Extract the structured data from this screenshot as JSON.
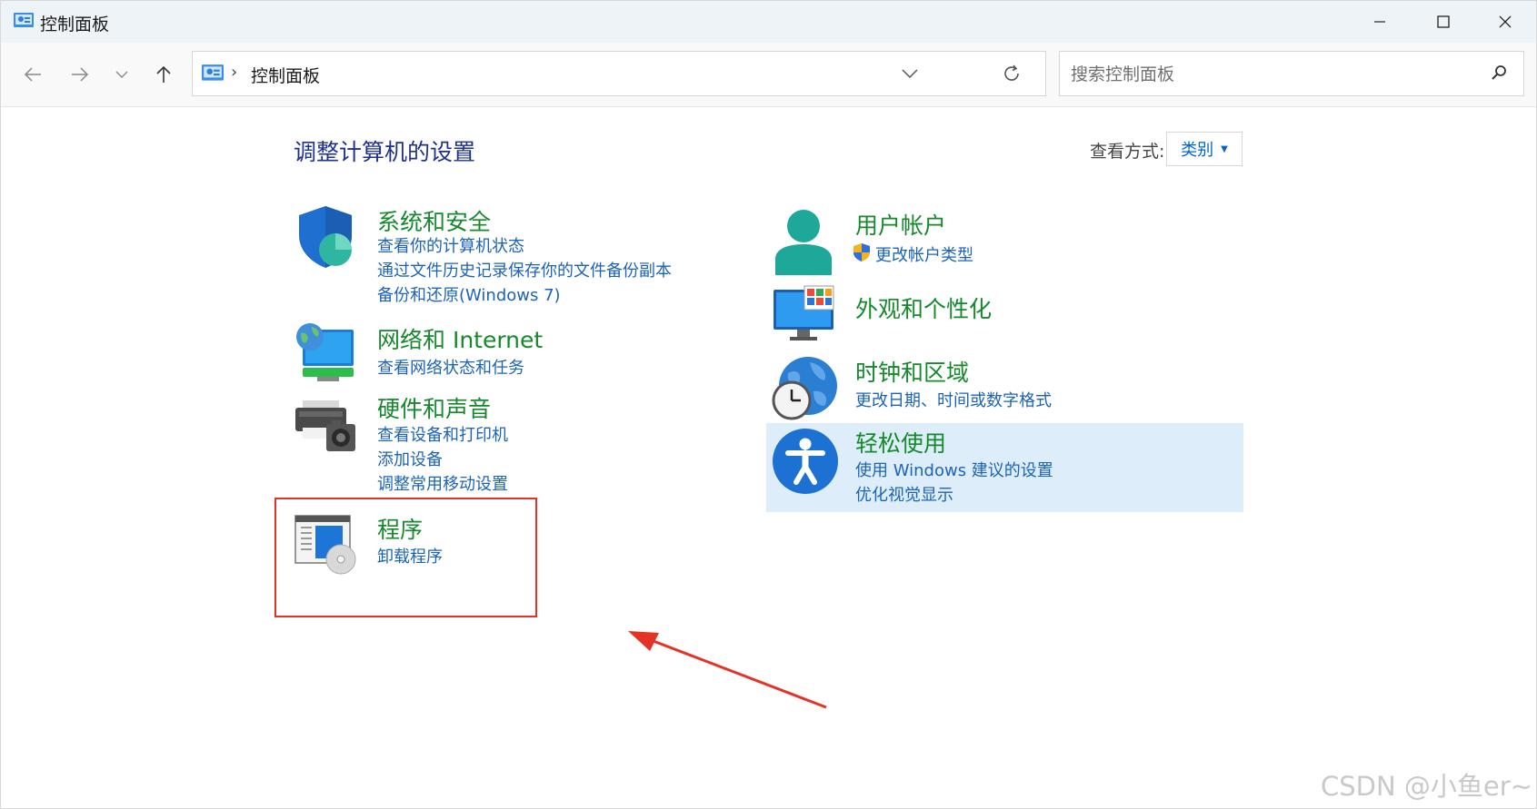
{
  "window": {
    "title": "控制面板"
  },
  "navbar": {
    "breadcrumb_sep": "›",
    "breadcrumb": "控制面板",
    "search_placeholder": "搜索控制面板"
  },
  "main": {
    "heading": "调整计算机的设置",
    "view_by_label": "查看方式:",
    "view_by_value": "类别"
  },
  "categories": {
    "system": {
      "title": "系统和安全",
      "links": [
        "查看你的计算机状态",
        "通过文件历史记录保存你的文件备份副本",
        "备份和还原(Windows 7)"
      ]
    },
    "network": {
      "title": "网络和 Internet",
      "links": [
        "查看网络状态和任务"
      ]
    },
    "hardware": {
      "title": "硬件和声音",
      "links": [
        "查看设备和打印机",
        "添加设备",
        "调整常用移动设置"
      ]
    },
    "programs": {
      "title": "程序",
      "links": [
        "卸载程序"
      ]
    },
    "accounts": {
      "title": "用户帐户",
      "links": [
        "更改帐户类型"
      ]
    },
    "appearance": {
      "title": "外观和个性化",
      "links": []
    },
    "clock": {
      "title": "时钟和区域",
      "links": [
        "更改日期、时间或数字格式"
      ]
    },
    "ease": {
      "title": "轻松使用",
      "links": [
        "使用 Windows 建议的设置",
        "优化视觉显示"
      ]
    }
  },
  "annotation": {
    "highlight_color": "#e53225"
  },
  "watermark": "CSDN @小鱼er~",
  "colors": {
    "category_title": "#15892c",
    "link": "#1d63b6",
    "heading": "#1e3287",
    "hover_bg": "#ddeefa"
  }
}
